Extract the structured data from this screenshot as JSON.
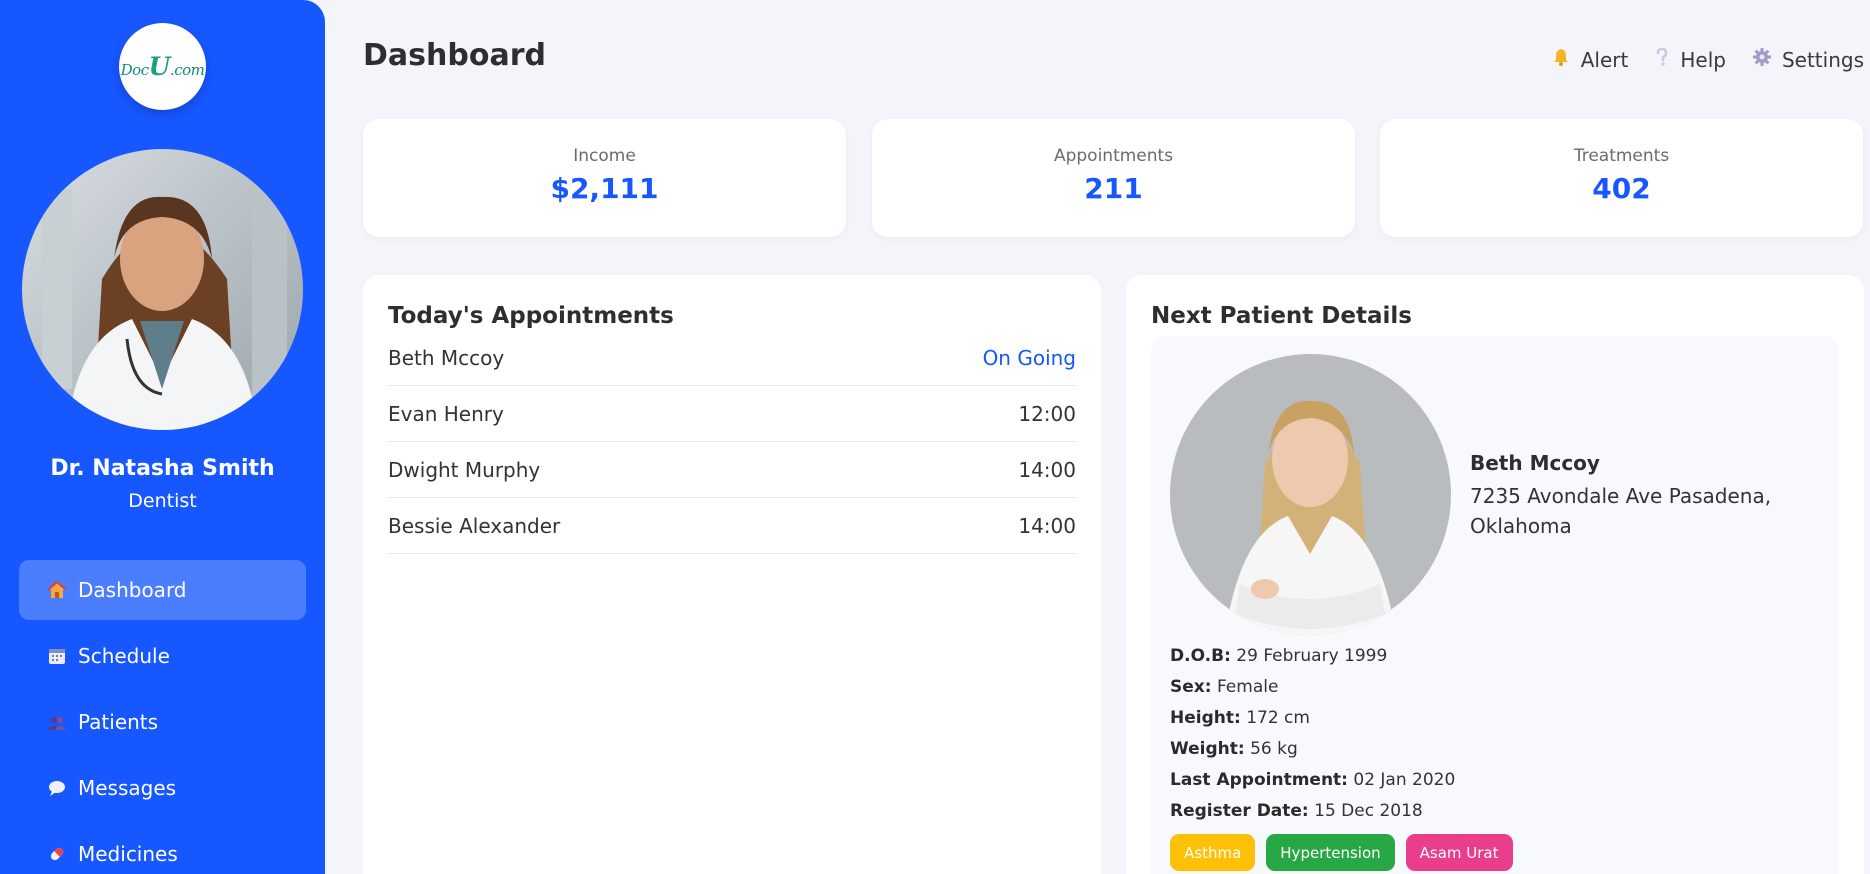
{
  "sidebar": {
    "logo_text_pre": "Doc",
    "logo_text_mid": "U",
    "logo_text_post": ".com",
    "doctor_name": "Dr. Natasha Smith",
    "doctor_role": "Dentist",
    "nav": [
      {
        "label": "Dashboard",
        "icon": "house-icon"
      },
      {
        "label": "Schedule",
        "icon": "calendar-icon"
      },
      {
        "label": "Patients",
        "icon": "people-icon"
      },
      {
        "label": "Messages",
        "icon": "speech-bubble-icon"
      },
      {
        "label": "Medicines",
        "icon": "pill-icon"
      }
    ]
  },
  "header": {
    "title": "Dashboard",
    "actions": [
      {
        "label": "Alert",
        "icon": "bell-icon"
      },
      {
        "label": "Help",
        "icon": "question-icon"
      },
      {
        "label": "Settings",
        "icon": "gear-icon"
      }
    ]
  },
  "stats": [
    {
      "label": "Income",
      "value": "$2,111"
    },
    {
      "label": "Appointments",
      "value": "211"
    },
    {
      "label": "Treatments",
      "value": "402"
    }
  ],
  "appointments": {
    "title": "Today's Appointments",
    "rows": [
      {
        "name": "Beth Mccoy",
        "time": "On Going"
      },
      {
        "name": "Evan Henry",
        "time": "12:00"
      },
      {
        "name": "Dwight Murphy",
        "time": "14:00"
      },
      {
        "name": "Bessie Alexander",
        "time": "14:00"
      }
    ]
  },
  "next_patient": {
    "title": "Next Patient Details",
    "name": "Beth Mccoy",
    "address": "7235 Avondale Ave Pasadena, Oklahoma",
    "details": [
      {
        "label": "D.O.B:",
        "value": "29 February 1999"
      },
      {
        "label": "Sex:",
        "value": "Female"
      },
      {
        "label": "Height:",
        "value": "172 cm"
      },
      {
        "label": "Weight:",
        "value": "56 kg"
      },
      {
        "label": "Last Appointment:",
        "value": "02 Jan 2020"
      },
      {
        "label": "Register Date:",
        "value": "15 Dec 2018"
      }
    ],
    "tags": [
      {
        "label": "Asthma",
        "color": "#ffc107"
      },
      {
        "label": "Hypertension",
        "color": "#28a745"
      },
      {
        "label": "Asam Urat",
        "color": "#e83e8c"
      }
    ]
  },
  "colors": {
    "primary": "#1757ff",
    "sidebar_active": "#4b7dff",
    "background": "#f3f5fa"
  }
}
